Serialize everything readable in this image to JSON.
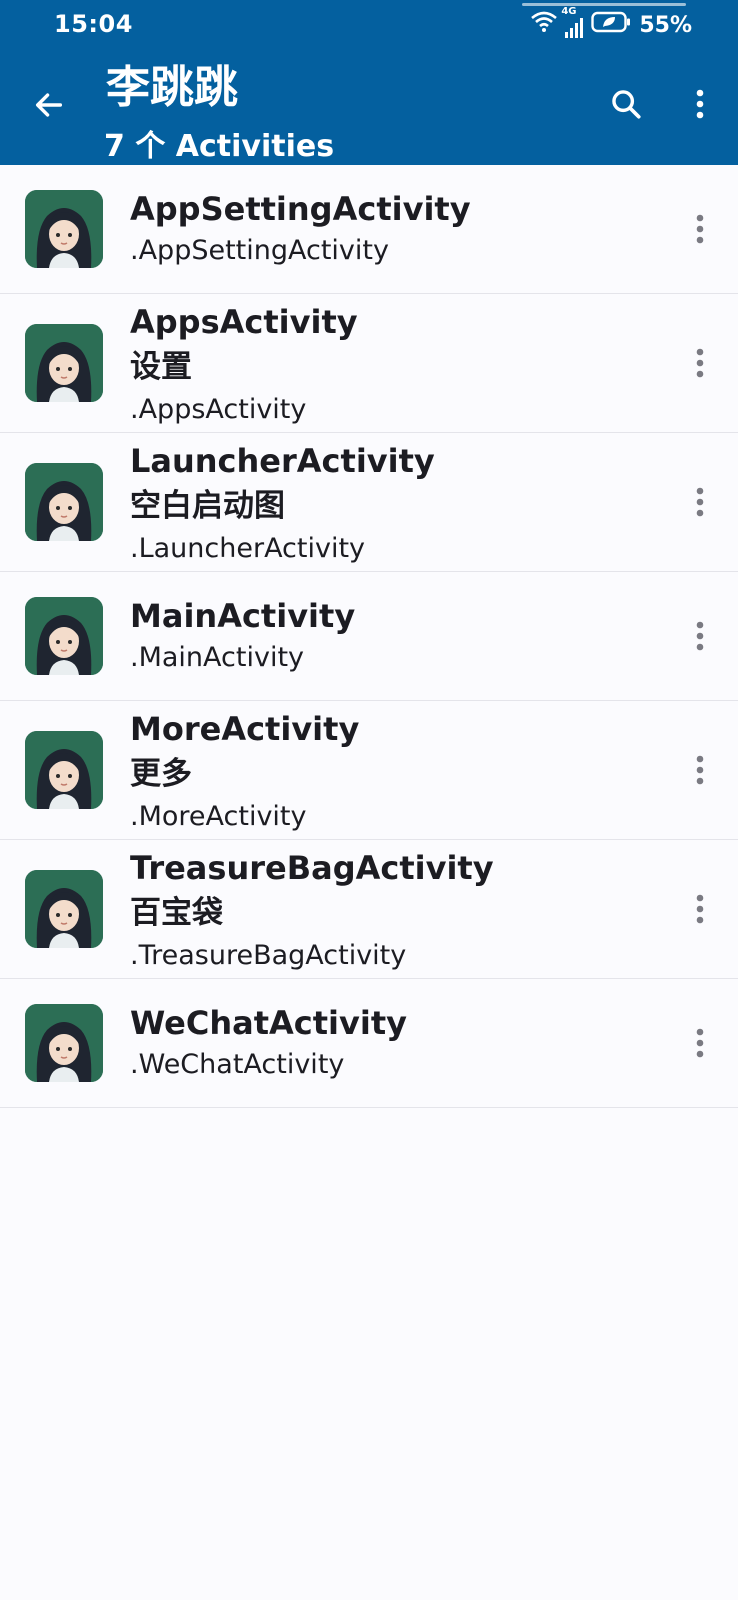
{
  "status_bar": {
    "time": "15:04",
    "network": "4G",
    "battery": "55%"
  },
  "header": {
    "title": "李跳跳",
    "subtitle": "7 个 Activities",
    "background_color": "#04609f",
    "icons": [
      "back-arrow-icon",
      "search-icon",
      "more-vert-icon"
    ]
  },
  "activities": [
    {
      "name": "AppSettingActivity",
      "label": "",
      "class_name": ".AppSettingActivity"
    },
    {
      "name": "AppsActivity",
      "label": "设置",
      "class_name": ".AppsActivity"
    },
    {
      "name": "LauncherActivity",
      "label": "空白启动图",
      "class_name": ".LauncherActivity"
    },
    {
      "name": "MainActivity",
      "label": "",
      "class_name": ".MainActivity"
    },
    {
      "name": "MoreActivity",
      "label": "更多",
      "class_name": ".MoreActivity"
    },
    {
      "name": "TreasureBagActivity",
      "label": "百宝袋",
      "class_name": ".TreasureBagActivity"
    },
    {
      "name": "WeChatActivity",
      "label": "",
      "class_name": ".WeChatActivity"
    }
  ]
}
